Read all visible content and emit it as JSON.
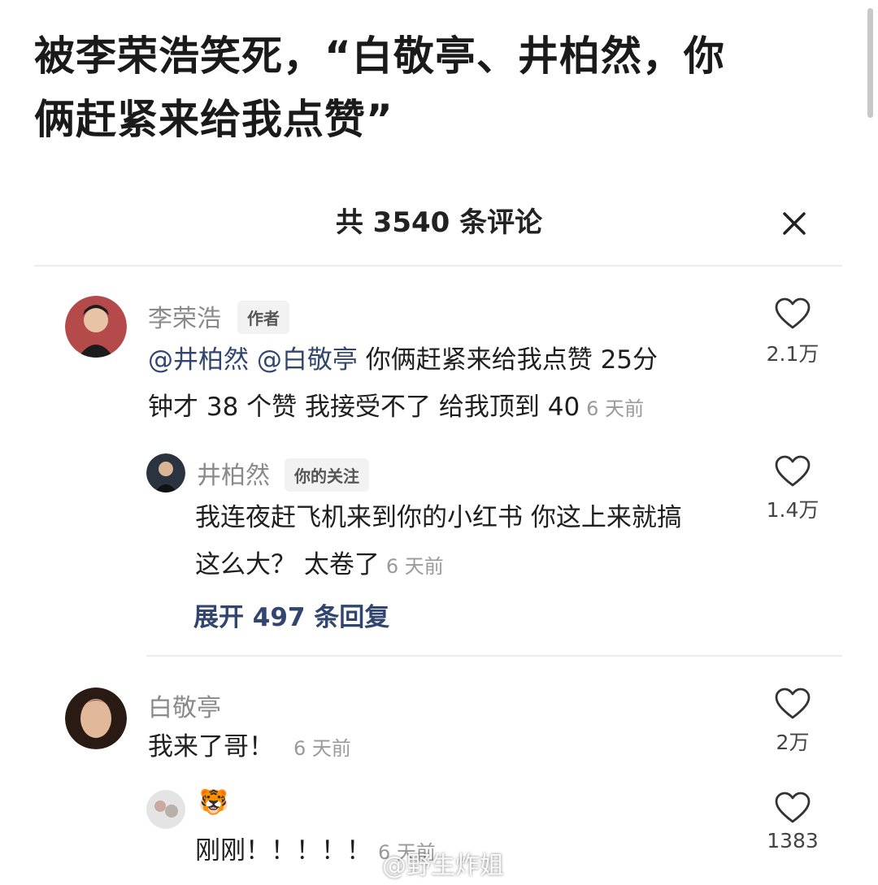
{
  "headline": {
    "line1": "被李荣浩笑死，“白敬亭、井柏然，你",
    "line2": "俩赶紧来给我点赞”"
  },
  "comments_sheet": {
    "title": "共 3540 条评论",
    "close_icon": "close-icon"
  },
  "comments": [
    {
      "author": "李荣浩",
      "tag": "作者",
      "mention1": "@井柏然",
      "mention2": "@白敬亭",
      "text_line1": " 你俩赶紧来给我点赞  25分",
      "text_line2": "钟才 38 个赞 我接受不了 给我顶到 40",
      "time": "6 天前",
      "likes": "2.1万",
      "avatar_color": "#b44a4a"
    },
    {
      "author": "井柏然",
      "tag": "你的关注",
      "text_line1": "我连夜赶飞机来到你的小红书 你这上来就搞",
      "text_line2": "这么大？ 太卷了",
      "time": "6 天前",
      "likes": "1.4万",
      "expand": "展开 497 条回复",
      "avatar_color": "#2c3340"
    },
    {
      "author": "白敬亭",
      "text": "我来了哥！",
      "time": "6 天前",
      "likes": "2万",
      "avatar_color": "#7a4a38"
    },
    {
      "author": "🐯",
      "text": "刚刚！！！！！",
      "time": "6 天前",
      "likes": "1383",
      "avatar_color": "#d9d9d9"
    }
  ],
  "watermark": "@野生炸姐",
  "colors": {
    "mention": "#31456f",
    "muted": "#8a8a8a",
    "divider": "#ececec"
  }
}
